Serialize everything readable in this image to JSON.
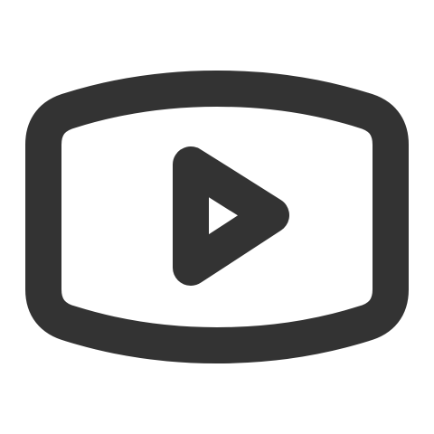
{
  "icon": {
    "name": "video-play-icon",
    "color": "#333333",
    "background": "#ffffff"
  }
}
